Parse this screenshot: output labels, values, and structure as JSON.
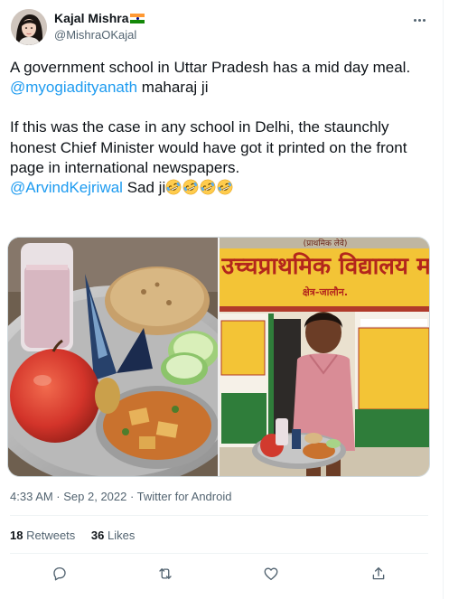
{
  "author": {
    "display_name": "Kajal Mishra",
    "handle": "@MishraOKajal",
    "flag_icon": "india-flag-icon"
  },
  "tweet": {
    "line1": "A government school in Uttar Pradesh has a mid day meal.",
    "mention1": "@myogiadityanath",
    "after_mention1": " maharaj ji",
    "paragraph2": "If this was the case in any school in Delhi, the staunchly honest Chief Minister would have got it printed on the front page in international newspapers.",
    "mention2": "@ArvindKejriwal",
    "after_mention2": " Sad ji",
    "emoji_name": "rolling-on-floor-laughing-emoji",
    "emoji_count": 4
  },
  "media": {
    "left_image": "food-thali-photo",
    "right_image": "schoolgirl-holding-plate-photo",
    "sign_top_text": "(प्राथमिक लेवे)",
    "sign_main_text": "उच्चप्राथमिक विद्यालय मलकु",
    "sign_sub_text": "क्षेत्र-जालौन."
  },
  "meta": {
    "timestamp": "4:33 AM · Sep 2, 2022 · Twitter for Android"
  },
  "stats": {
    "retweets_count": "18",
    "retweets_label": "Retweets",
    "likes_count": "36",
    "likes_label": "Likes"
  },
  "colors": {
    "accent": "#1d9bf0",
    "text": "#0f1419",
    "secondary": "#536471",
    "divider": "#eff3f4"
  }
}
